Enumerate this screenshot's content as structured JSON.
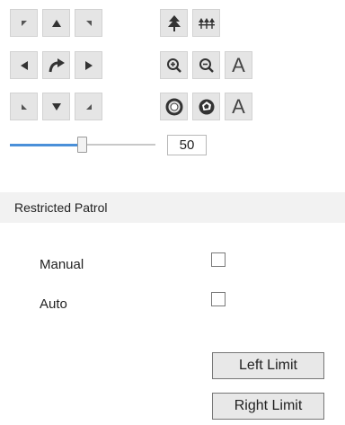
{
  "ptz": {
    "direction_buttons": [
      "up-left",
      "up",
      "up-right",
      "left",
      "auto-pan",
      "right",
      "down-left",
      "down",
      "down-right"
    ],
    "lens_buttons": [
      "focus-icon",
      "zoom-in",
      "zoom-out",
      "focus-letter",
      "iris-close",
      "iris-open",
      "iris-letter"
    ],
    "focus_label": "A",
    "iris_label": "A",
    "speed_value": "50",
    "slider_fraction": 0.5,
    "accent_color": "#4a90d9"
  },
  "restricted_patrol": {
    "title": "Restricted Patrol",
    "manual_label": "Manual",
    "manual_checked": false,
    "auto_label": "Auto",
    "auto_checked": false,
    "left_limit_label": "Left Limit",
    "right_limit_label": "Right Limit"
  }
}
